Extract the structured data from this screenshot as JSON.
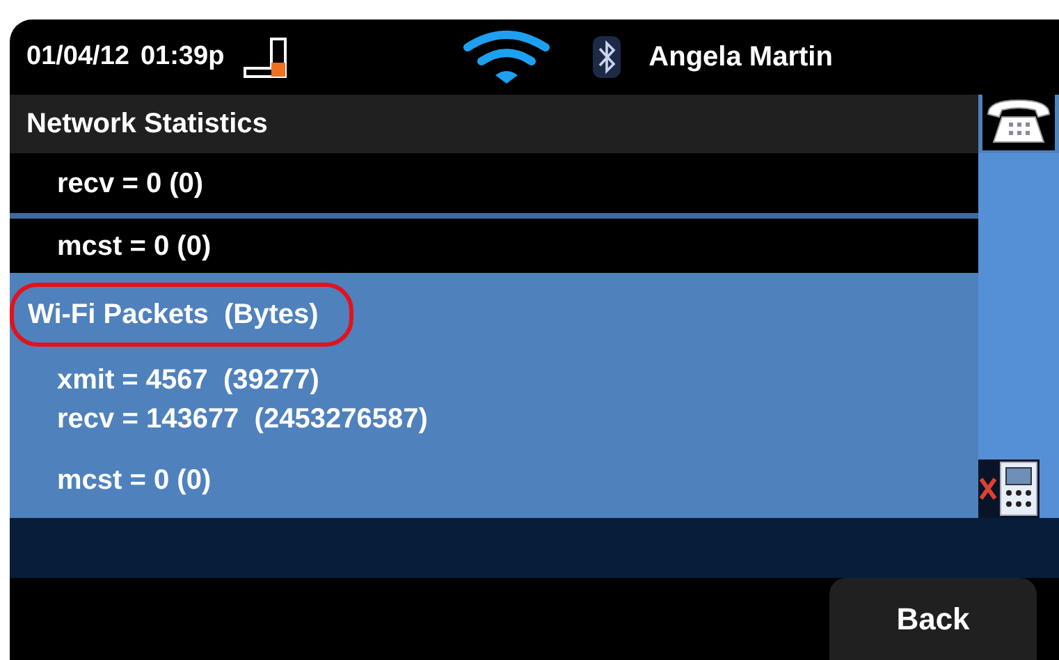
{
  "status_bar": {
    "date": "01/04/12",
    "time": "01:39p",
    "user": "Angela Martin"
  },
  "title": "Network Statistics",
  "sections": [
    {
      "kind": "previous",
      "lines": [
        "recv = 0 (0)",
        "mcst = 0 (0)"
      ]
    },
    {
      "kind": "current",
      "heading": {
        "text": "Wi-Fi Packets  (Bytes)",
        "highlighted": true
      },
      "line_groups": [
        [
          "xmit = 4567  (39277)",
          "recv = 143677  (2453276587)"
        ],
        [
          "mcst = 0 (0)"
        ]
      ]
    }
  ],
  "softkeys": [
    {
      "label": "Back"
    }
  ]
}
